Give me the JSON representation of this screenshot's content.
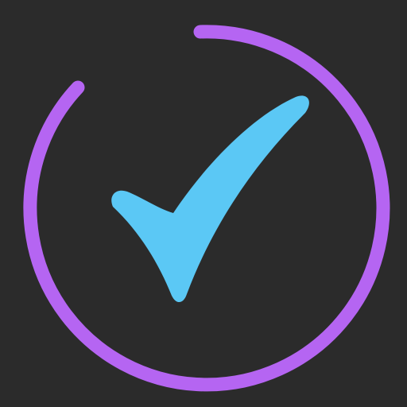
{
  "app_icon": {
    "semantic": "checkmark-in-open-ring-icon",
    "colors": {
      "background": "#2b2b2b",
      "ring": "#b565f2",
      "checkmark": "#5bc8f5"
    }
  }
}
